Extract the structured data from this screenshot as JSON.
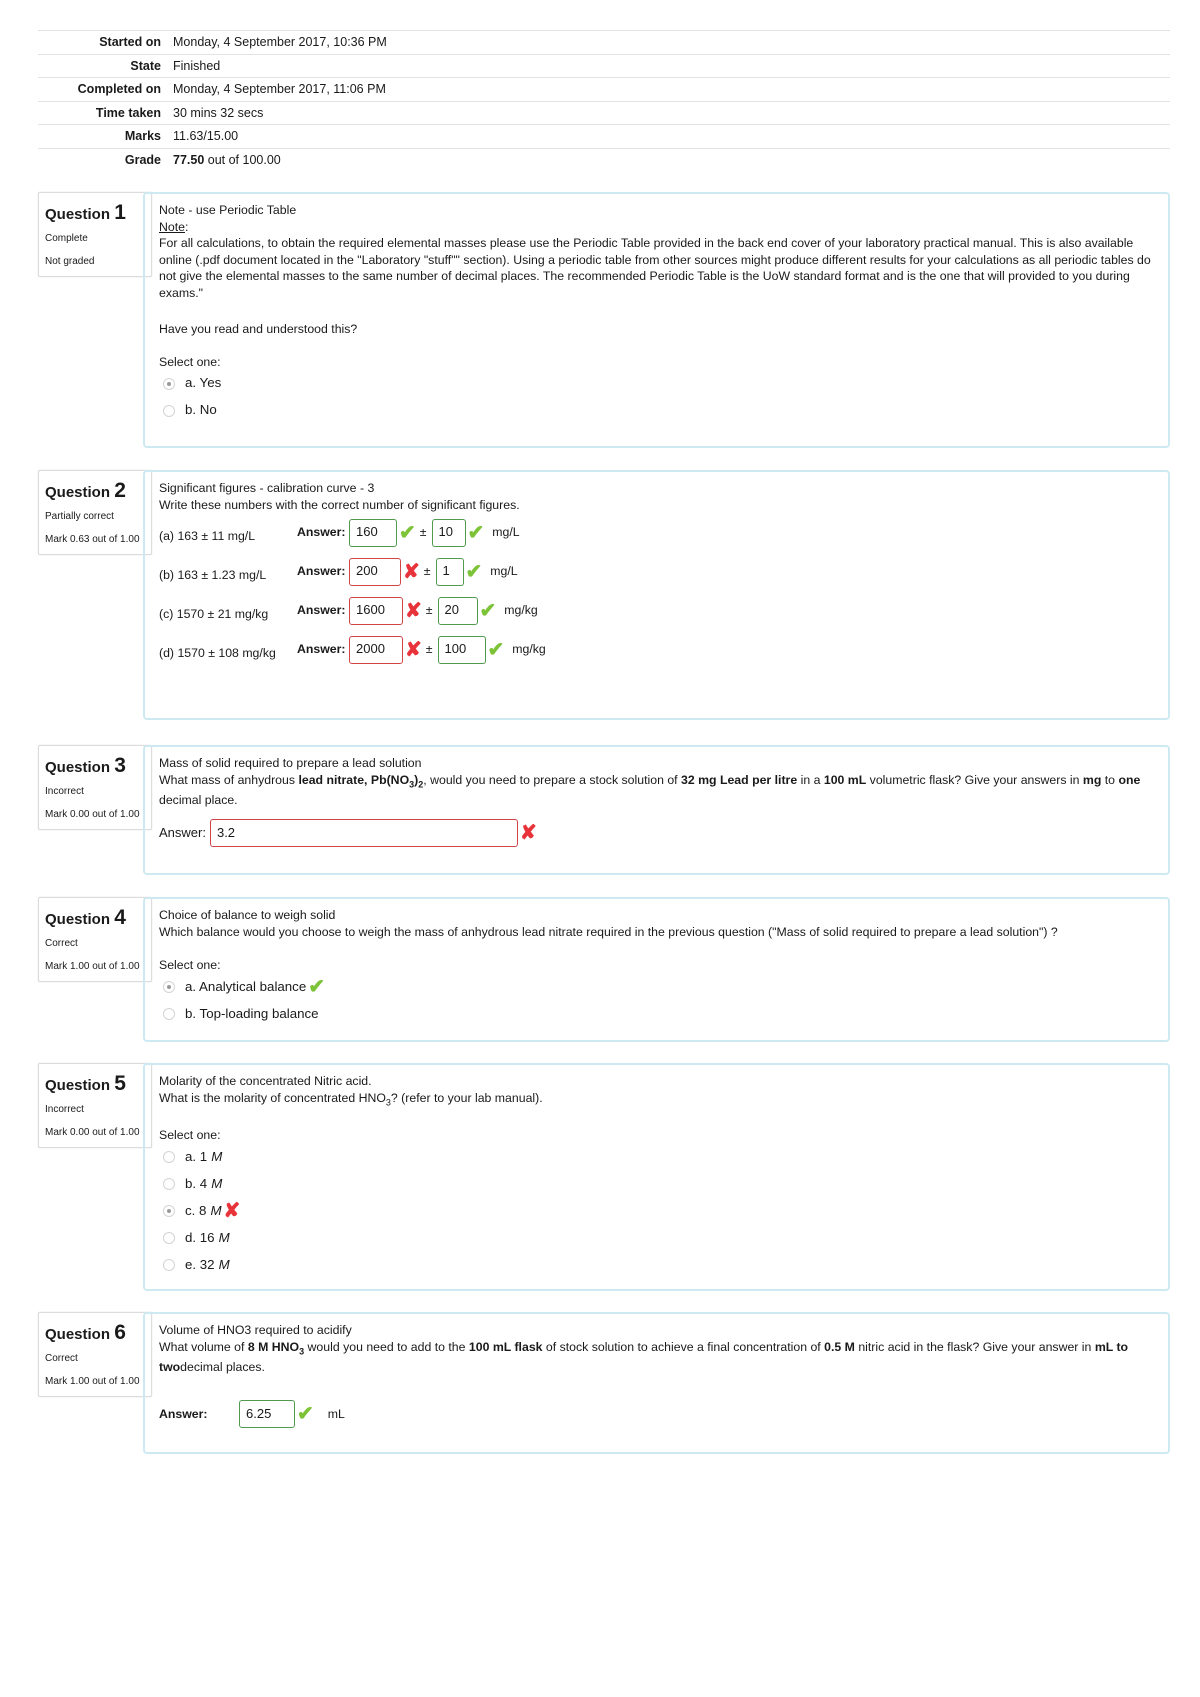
{
  "summary": [
    {
      "label": "Started on",
      "value": "Monday, 4 September 2017, 10:36 PM"
    },
    {
      "label": "State",
      "value": "Finished"
    },
    {
      "label": "Completed on",
      "value": "Monday, 4 September 2017, 11:06 PM"
    },
    {
      "label": "Time taken",
      "value": "30 mins 32 secs"
    },
    {
      "label": "Marks",
      "value": "11.63/15.00"
    },
    {
      "label": "Grade",
      "value_bold": "77.50",
      "value_rest": " out of 100.00"
    }
  ],
  "q1": {
    "label": "Question",
    "number": "1",
    "state": "Complete",
    "mark": "Not graded",
    "title": "Note - use Periodic Table",
    "note_label": "Note",
    "note_body": "For all calculations, to obtain the required elemental masses please use the Periodic Table provided in the back end cover of your laboratory practical manual. This is also available online (.pdf document located in the \"Laboratory \"stuff\"\" section). Using a periodic table from other sources might produce different results for your calculations as all periodic tables do not give the elemental masses to the same number of decimal places. The recommended Periodic Table is the UoW standard format and is the one that will provided to you during exams.\"",
    "prompt": "Have you read and understood this?",
    "select": "Select one:",
    "options": [
      {
        "label": "a. Yes",
        "selected": true
      },
      {
        "label": "b. No",
        "selected": false
      }
    ]
  },
  "q2": {
    "label": "Question",
    "number": "2",
    "state": "Partially correct",
    "mark": "Mark 0.63 out of 1.00",
    "title": "Significant figures - calibration curve - 3",
    "prompt": "Write these numbers with the correct number of significant figures.",
    "answer_label": "Answer:",
    "pm": "±",
    "rows": [
      {
        "part": "(a) 163 ± 11 mg/L",
        "value": "160",
        "value_correct": true,
        "unc": "10",
        "unc_correct": true,
        "unit": "mg/L"
      },
      {
        "part": "(b) 163 ± 1.23 mg/L",
        "value": "200",
        "value_correct": false,
        "unc": "1",
        "unc_correct": true,
        "unit": "mg/L"
      },
      {
        "part": "(c) 1570 ± 21 mg/kg",
        "value": "1600",
        "value_correct": false,
        "unc": "20",
        "unc_correct": true,
        "unit": "mg/kg"
      },
      {
        "part": "(d) 1570 ± 108 mg/kg",
        "value": "2000",
        "value_correct": false,
        "unc": "100",
        "unc_correct": true,
        "unit": "mg/kg"
      }
    ]
  },
  "q3": {
    "label": "Question",
    "number": "3",
    "state": "Incorrect",
    "mark": "Mark 0.00 out of 1.00",
    "title": "Mass of solid required to prepare a lead solution",
    "t1": "What mass of anhydrous ",
    "b1": "lead nitrate, Pb(NO",
    "b1sub": "3",
    "b1end": ")",
    "b1sub2": "2",
    "t2": ", would you need to prepare a stock solution of ",
    "b2": "32 mg Lead per litre",
    "t3": " in a ",
    "b3": "100 mL",
    "t4": " volumetric flask? Give your answers in ",
    "b4": "mg",
    "t5": " to ",
    "b5": "one",
    "t6": " decimal place.",
    "answer_label": "Answer:",
    "answer": "3.2",
    "correct": false
  },
  "q4": {
    "label": "Question",
    "number": "4",
    "state": "Correct",
    "mark": "Mark 1.00 out of 1.00",
    "title": "Choice of balance to weigh solid",
    "prompt": "Which balance would you choose to weigh the mass of anhydrous lead nitrate required in the previous question (\"Mass of solid required to prepare a lead solution\") ?",
    "select": "Select one:",
    "options": [
      {
        "label": "a. Analytical balance",
        "selected": true,
        "feedback": "check"
      },
      {
        "label": "b. Top-loading balance",
        "selected": false
      }
    ]
  },
  "q5": {
    "label": "Question",
    "number": "5",
    "state": "Incorrect",
    "mark": "Mark 0.00 out of 1.00",
    "title": "Molarity of the concentrated Nitric acid.",
    "p1": "What is the molarity of concentrated HNO",
    "psub": "3",
    "p2": "? (refer to your lab manual).",
    "select": "Select one:",
    "unit": "M",
    "options": [
      {
        "label": "a. 1",
        "selected": false
      },
      {
        "label": "b. 4",
        "selected": false
      },
      {
        "label": "c. 8",
        "selected": true,
        "feedback": "cross"
      },
      {
        "label": "d. 16",
        "selected": false
      },
      {
        "label": "e. 32",
        "selected": false
      }
    ]
  },
  "q6": {
    "label": "Question",
    "number": "6",
    "state": "Correct",
    "mark": "Mark 1.00 out of 1.00",
    "title": "Volume of HNO3 required to acidify",
    "t1": "What volume of ",
    "b1": "8 M HNO",
    "b1sub": "3",
    "t2": " would you need to add to the ",
    "b2": "100 mL flask",
    "t3": " of stock solution to achieve a final concentration of ",
    "b3": "0.5 M",
    "t4": " nitric acid in the flask? Give your answer in ",
    "b4": "mL to two",
    "t5": "decimal places.",
    "answer_label": "Answer:",
    "answer": "6.25",
    "unit": "mL",
    "correct": true
  },
  "icons": {
    "check": "✔",
    "cross": "✘"
  }
}
